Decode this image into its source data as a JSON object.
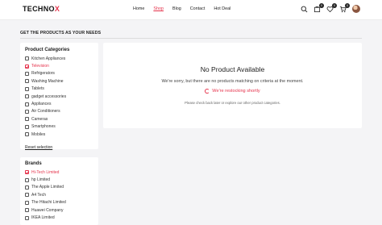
{
  "header": {
    "logo_main": "TECHNO",
    "logo_accent": "X",
    "nav": [
      "Home",
      "Shop",
      "Blog",
      "Contact",
      "Hot Deal"
    ],
    "active_nav": "Shop",
    "badges": {
      "compare": "0",
      "wishlist": "0",
      "cart": "0"
    }
  },
  "page": {
    "section_title": "GET THE PRODUCTS AS YOUR NEEDS"
  },
  "categories": {
    "heading": "Product Categories",
    "items": [
      {
        "label": "Kitchen Appliances",
        "checked": false
      },
      {
        "label": "Television",
        "checked": true
      },
      {
        "label": "Refrigerators",
        "checked": false
      },
      {
        "label": "Washing Machine",
        "checked": false
      },
      {
        "label": "Tablets",
        "checked": false
      },
      {
        "label": "gadget accessories",
        "checked": false
      },
      {
        "label": "Appliances",
        "checked": false
      },
      {
        "label": "Air Conditioners",
        "checked": false
      },
      {
        "label": "Cameras",
        "checked": false
      },
      {
        "label": "Smartphones",
        "checked": false
      },
      {
        "label": "Mobiles",
        "checked": false
      }
    ],
    "reset_label": "Reset selection"
  },
  "brands": {
    "heading": "Brands",
    "items": [
      {
        "label": "Hi-Tech Limited",
        "checked": true
      },
      {
        "label": "hp Limited",
        "checked": false
      },
      {
        "label": "The Apple Limited",
        "checked": false
      },
      {
        "label": "A4 Tech",
        "checked": false
      },
      {
        "label": "The Hitachi Limited",
        "checked": false
      },
      {
        "label": "Huawei Company",
        "checked": false
      },
      {
        "label": "IKEA Limited",
        "checked": false
      }
    ]
  },
  "empty_state": {
    "title": "No Product Available",
    "message": "We're sorry, but there are no products matching on criteria at the moment.",
    "restock": "We're restocking shortly",
    "sub": "Please check back later or explore our other product categories."
  },
  "colors": {
    "accent": "#e5334c",
    "background": "#f4f4f6",
    "panel": "#ffffff"
  },
  "icons": [
    "search-icon",
    "compare-icon",
    "heart-icon",
    "cart-icon",
    "avatar"
  ]
}
